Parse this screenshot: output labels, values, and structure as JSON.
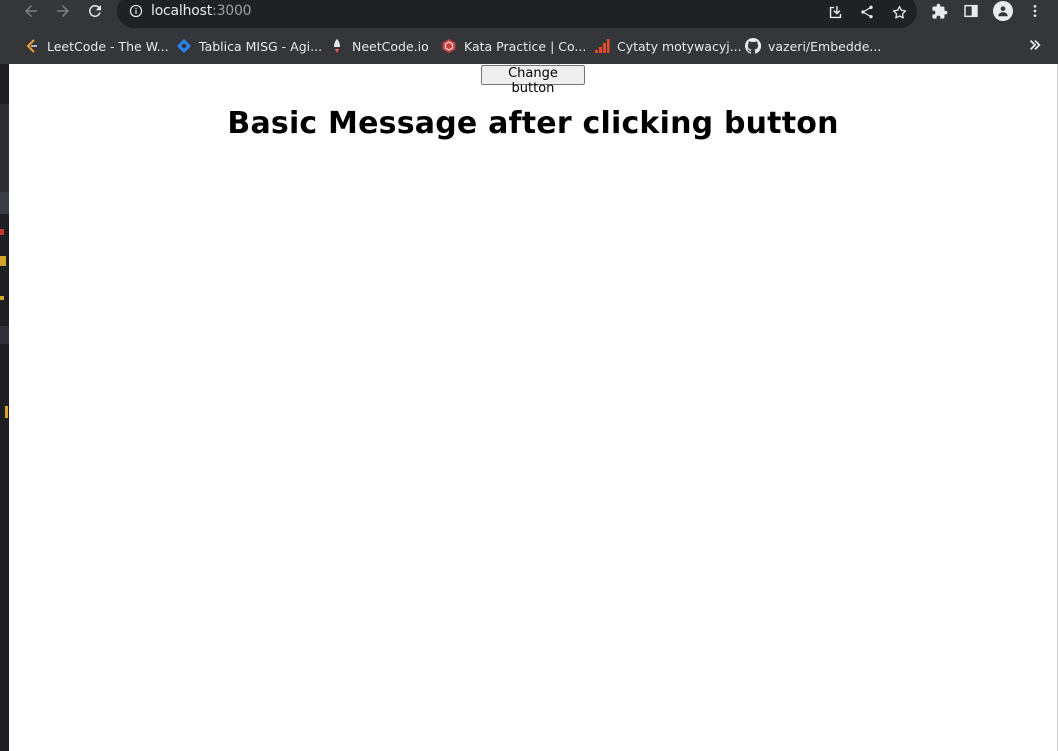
{
  "browser": {
    "url_host": "localhost",
    "url_port": ":3000"
  },
  "bookmarks": [
    {
      "label": "LeetCode - The W...",
      "icon": "leetcode-icon"
    },
    {
      "label": "Tablica MISG - Agi...",
      "icon": "jira-icon"
    },
    {
      "label": "NeetCode.io",
      "icon": "neetcode-icon"
    },
    {
      "label": "Kata Practice | Co...",
      "icon": "codewars-icon"
    },
    {
      "label": "Cytaty motywacyj...",
      "icon": "bars-icon"
    },
    {
      "label": "vazeri/Embedde...",
      "icon": "github-icon"
    }
  ],
  "page": {
    "button_label": "Change button",
    "heading": "Basic Message after clicking button"
  },
  "colors": {
    "chrome": "#35363a",
    "omnibox": "#202124",
    "page_bg": "#ffffff"
  }
}
